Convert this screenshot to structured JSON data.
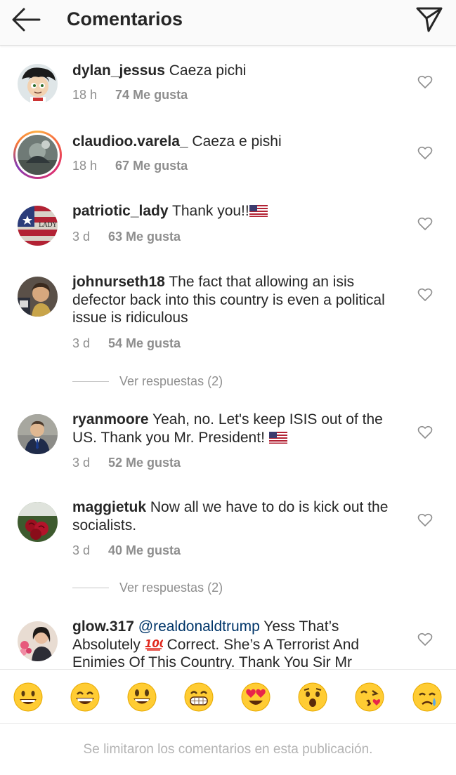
{
  "header": {
    "title": "Comentarios",
    "back_icon": "arrow-left-icon",
    "send_icon": "paper-plane-icon"
  },
  "comments": [
    {
      "username": "dylan_jessus",
      "text": " Caeza pichi",
      "time": "18 h",
      "likes": "74 Me gusta"
    },
    {
      "username": "claudioo.varela_",
      "text": " Caeza e pishi",
      "time": "18 h",
      "likes": "67 Me gusta"
    },
    {
      "username": "patriotic_lady",
      "text": " Thank you!!",
      "time": "3 d",
      "likes": "63 Me gusta"
    },
    {
      "username": "johnurseth18",
      "text": " The fact that allowing an isis defector back into this country is even a political issue is ridiculous",
      "time": "3 d",
      "likes": "54 Me gusta",
      "replies": "Ver respuestas (2)"
    },
    {
      "username": "ryanmoore",
      "text": " Yeah, no. Let's keep ISIS out of the US. Thank you Mr. President! ",
      "time": "3 d",
      "likes": "52 Me gusta"
    },
    {
      "username": "maggietuk",
      "text": " Now all we have to do is kick out the socialists.",
      "time": "3 d",
      "likes": "40 Me gusta",
      "replies": "Ver respuestas (2)"
    },
    {
      "username": "glow.317",
      "mention": " @realdonaldtrump",
      "text": " Yess That’s Absolutely ",
      "text_after": " Correct. She’s A Terrorist And Enimies Of This Country. Thank You Sir Mr"
    }
  ],
  "emoji_bar": [
    "grinning-face-icon",
    "grinning-face-smiling-eyes-icon",
    "smiley-face-icon",
    "grimacing-face-icon",
    "heart-eyes-face-icon",
    "hushed-face-icon",
    "face-blowing-kiss-icon",
    "crying-face-icon"
  ],
  "footer": {
    "notice": "Se limitaron los comentarios en esta publicación."
  },
  "colors": {
    "text": "#262626",
    "muted": "#8e8e8e",
    "mention": "#003569",
    "header_bg": "#fafafa"
  }
}
